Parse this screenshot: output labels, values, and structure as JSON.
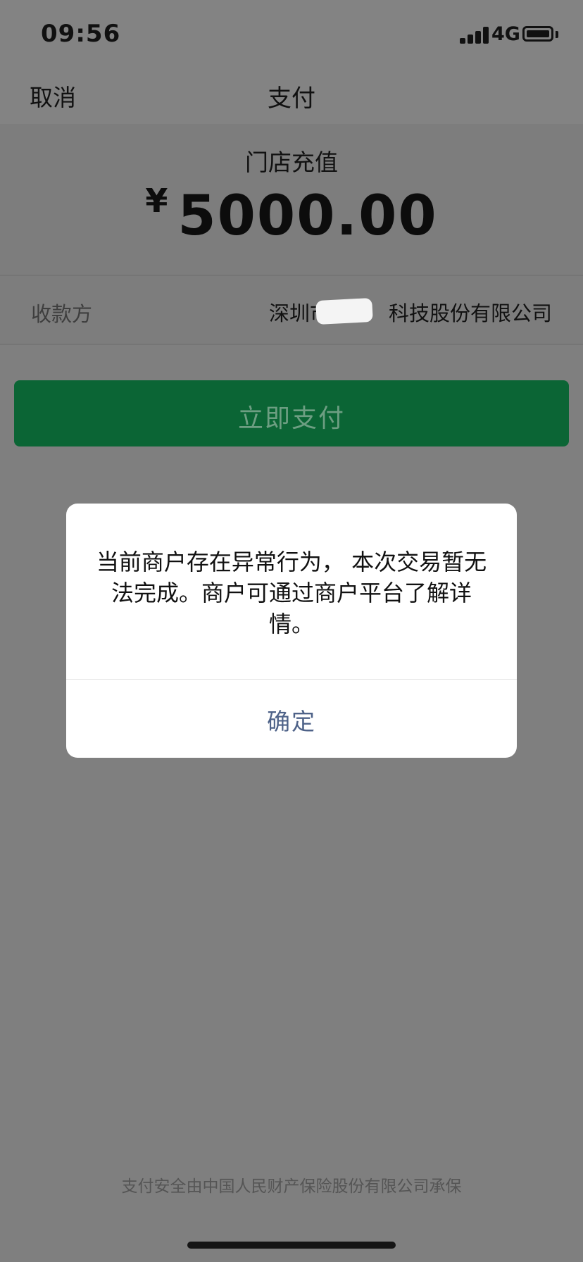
{
  "status_bar": {
    "time": "09:56",
    "network": "4G",
    "icons": [
      "signal-icon",
      "battery-icon"
    ]
  },
  "nav": {
    "cancel": "取消",
    "title": "支付"
  },
  "payment": {
    "merchant_title": "门店充值",
    "currency": "¥",
    "amount": "5000.00"
  },
  "payee": {
    "label": "收款方",
    "value": "深圳市         科技股份有限公司"
  },
  "pay_button": {
    "label": "立即支付"
  },
  "dialog": {
    "message": "当前商户存在异常行为， 本次交易暂无法完成。商户可通过商户平台了解详情。",
    "confirm": "确定"
  },
  "footer": {
    "text": "支付安全由中国人民财产保险股份有限公司承保"
  },
  "colors": {
    "pay_button": "#0b6535",
    "dialog_button": "#4e6288",
    "overlay": "#7f7f7f"
  }
}
